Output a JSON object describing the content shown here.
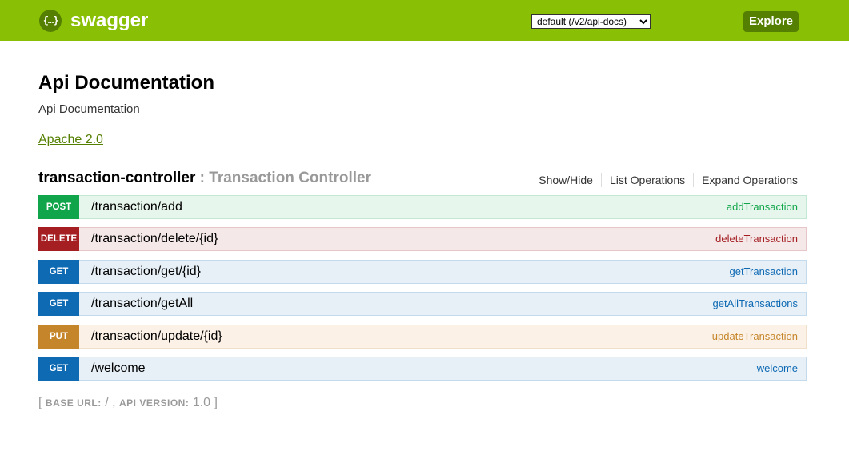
{
  "header": {
    "logo_icon": "{…}",
    "logo_text": "swagger",
    "spec_select_value": "default (/v2/api-docs)",
    "explore_label": "Explore",
    "colors": {
      "bar": "#89bf04",
      "accent": "#547f00"
    }
  },
  "info": {
    "title": "Api Documentation",
    "description": "Api Documentation",
    "license": "Apache 2.0"
  },
  "controller": {
    "name": "transaction-controller",
    "separator": " : ",
    "description": "Transaction Controller",
    "links": [
      "Show/Hide",
      "List Operations",
      "Expand Operations"
    ]
  },
  "operations": [
    {
      "method": "POST",
      "path": "/transaction/add",
      "nickname": "addTransaction"
    },
    {
      "method": "DELETE",
      "path": "/transaction/delete/{id}",
      "nickname": "deleteTransaction"
    },
    {
      "method": "GET",
      "path": "/transaction/get/{id}",
      "nickname": "getTransaction"
    },
    {
      "method": "GET",
      "path": "/transaction/getAll",
      "nickname": "getAllTransactions"
    },
    {
      "method": "PUT",
      "path": "/transaction/update/{id}",
      "nickname": "updateTransaction"
    },
    {
      "method": "GET",
      "path": "/welcome",
      "nickname": "welcome"
    }
  ],
  "method_colors": {
    "POST": "#10a54a",
    "DELETE": "#a41e22",
    "GET": "#0f6ab4",
    "PUT": "#c5862b"
  },
  "footer": {
    "open_bracket": "[",
    "base_url_label": "BASE URL",
    "base_url_value": "/",
    "api_version_label": "API VERSION",
    "api_version_value": "1.0",
    "close_bracket": "]"
  }
}
